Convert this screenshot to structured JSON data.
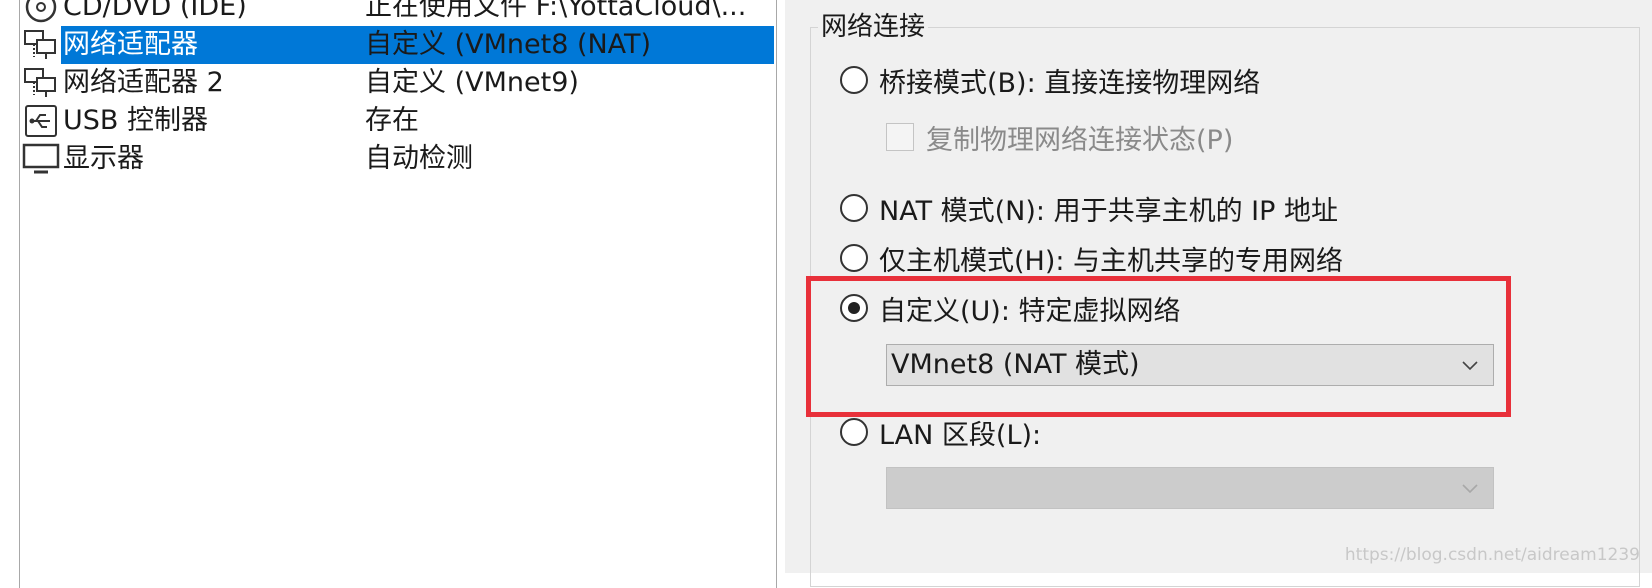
{
  "device_list": {
    "rows": [
      {
        "name": "CD/DVD (IDE)",
        "summary": "正在使用文件 F:\\YottaCloud\\...",
        "icon": "cd-dvd-icon"
      },
      {
        "name": "网络适配器",
        "summary": "自定义 (VMnet8 (NAT)",
        "icon": "network-adapter-icon",
        "selected": true
      },
      {
        "name": "网络适配器 2",
        "summary": "自定义 (VMnet9)",
        "icon": "network-adapter-icon"
      },
      {
        "name": "USB 控制器",
        "summary": "存在",
        "icon": "usb-icon"
      },
      {
        "name": "显示器",
        "summary": "自动检测",
        "icon": "monitor-icon"
      }
    ]
  },
  "network_connection": {
    "title": "网络连接",
    "bridged": {
      "label": "桥接模式(B): 直接连接物理网络",
      "checked": false
    },
    "replicate": {
      "label": "复制物理网络连接状态(P)",
      "checked": false,
      "enabled": false
    },
    "nat": {
      "label": "NAT 模式(N): 用于共享主机的 IP 地址",
      "checked": false
    },
    "host_only": {
      "label": "仅主机模式(H): 与主机共享的专用网络",
      "checked": false
    },
    "custom": {
      "label": "自定义(U): 特定虚拟网络",
      "checked": true
    },
    "custom_select": {
      "value": "VMnet8 (NAT 模式)"
    },
    "lan_segment": {
      "label": "LAN 区段(L):",
      "checked": false
    },
    "lan_select": {
      "value": "",
      "enabled": false
    }
  },
  "colors": {
    "selection": "#0078d7",
    "highlight": "#e8303a"
  },
  "watermark": "https://blog.csdn.net/aidream1239"
}
